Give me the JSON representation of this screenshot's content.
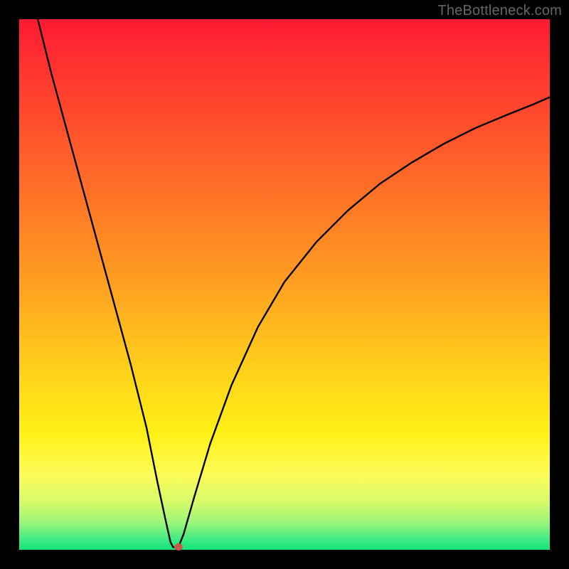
{
  "watermark": "TheBottleneck.com",
  "chart_data": {
    "type": "line",
    "title": "",
    "xlabel": "",
    "ylabel": "",
    "xlim": [
      0,
      100
    ],
    "ylim": [
      0,
      100
    ],
    "grid": false,
    "legend": false,
    "series": [
      {
        "name": "curve",
        "x": [
          3.5,
          6,
          9,
          12,
          15,
          18,
          21,
          24,
          26,
          27.5,
          28.5,
          29,
          30,
          31,
          33,
          36,
          40,
          45,
          50,
          56,
          62,
          68,
          74,
          80,
          86,
          92,
          97,
          100
        ],
        "y": [
          100,
          90,
          79,
          68,
          57,
          46,
          35,
          23,
          13,
          6,
          1.5,
          0.5,
          0.5,
          3,
          10,
          20,
          31,
          42,
          50.5,
          58,
          64,
          69,
          73,
          76.5,
          79.5,
          82,
          84,
          85.3
        ]
      }
    ],
    "marker": {
      "x": 30.0,
      "y": 0.6,
      "color": "#c95a4a"
    },
    "colors": {
      "frame": "#000000",
      "curve": "#000000",
      "gradient_top": "#ff1a33",
      "gradient_bottom": "#12e47a",
      "watermark": "#666666"
    }
  }
}
